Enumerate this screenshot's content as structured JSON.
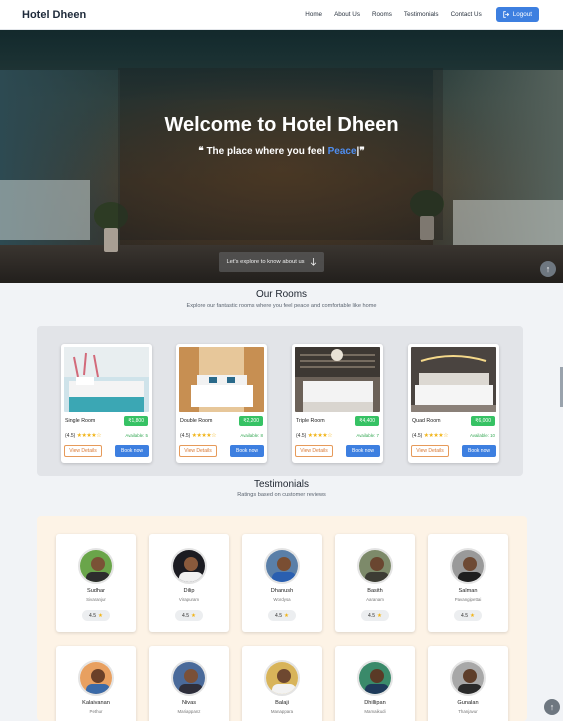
{
  "nav": {
    "brand": "Hotel Dheen",
    "links": [
      "Home",
      "About Us",
      "Rooms",
      "Testimonials",
      "Contact Us"
    ],
    "logout_label": "Logout"
  },
  "hero": {
    "title": "Welcome to Hotel Dheen",
    "subtitle_prefix": "❝ The place where you feel ",
    "subtitle_accent": "Peace",
    "subtitle_suffix": "|❞",
    "explore_label": "Let's explore to know about us"
  },
  "rooms": {
    "title": "Our Rooms",
    "subtitle": "Explore our fantastic rooms where you feel peace and comfortable like home",
    "view_label": "View Details",
    "book_label": "Book now",
    "items": [
      {
        "name": "Single Room",
        "price": "₹1,800",
        "rating": "(4.5)",
        "stars": "★★★★☆",
        "available": "Available: 5"
      },
      {
        "name": "Double Room",
        "price": "₹2,200",
        "rating": "(4.5)",
        "stars": "★★★★☆",
        "available": "Available: 8"
      },
      {
        "name": "Triple Room",
        "price": "₹4,400",
        "rating": "(4.5)",
        "stars": "★★★★☆",
        "available": "Available: 7"
      },
      {
        "name": "Quad Room",
        "price": "₹6,000",
        "rating": "(4.5)",
        "stars": "★★★★☆",
        "available": "Available: 10"
      }
    ]
  },
  "testimonials": {
    "title": "Testimonials",
    "subtitle": "Ratings based on customer reviews",
    "items": [
      {
        "name": "Sudhar",
        "location": "Sivaranjur",
        "rating": "4.5"
      },
      {
        "name": "Dilip",
        "location": "Virapuram",
        "rating": "4.5"
      },
      {
        "name": "Dhanush",
        "location": "Wordysa",
        "rating": "4.5"
      },
      {
        "name": "Basith",
        "location": "Aaranam",
        "rating": "4.5"
      },
      {
        "name": "Salman",
        "location": "Pavangipettai",
        "rating": "4.5"
      },
      {
        "name": "Kalaivanan",
        "location": "Pethur",
        "rating": ""
      },
      {
        "name": "Nivas",
        "location": "Mariappanz",
        "rating": ""
      },
      {
        "name": "Balaji",
        "location": "Manappara",
        "rating": ""
      },
      {
        "name": "Dhillipan",
        "location": "Mamaikudi",
        "rating": ""
      },
      {
        "name": "Gunalan",
        "location": "Thanjavur",
        "rating": ""
      }
    ]
  },
  "scroll_top_symbol": "↑"
}
